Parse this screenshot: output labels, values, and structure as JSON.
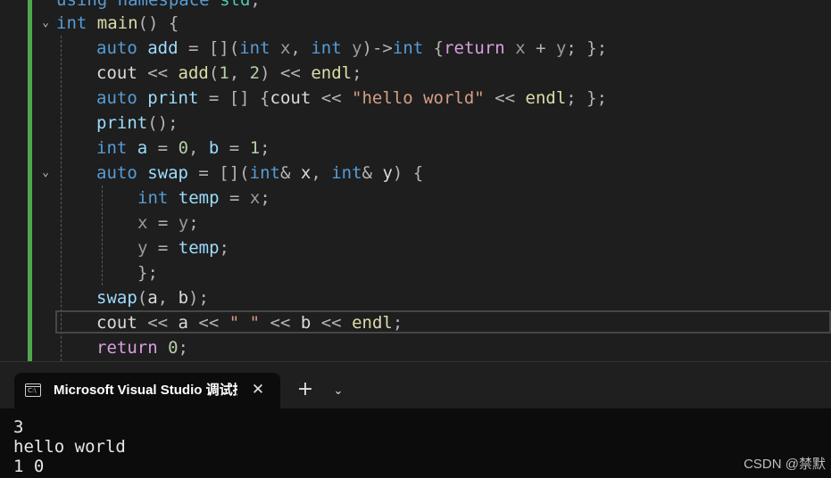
{
  "editor": {
    "lines": {
      "l0": {
        "a": "using",
        "b": "namespace",
        "c": "std",
        "d": ";"
      },
      "l1": {
        "a": "int",
        "b": "main",
        "c": "() {"
      },
      "l2": {
        "a": "auto",
        "b": "add",
        "c": " = [](",
        "d": "int",
        "e": "x",
        "f": ", ",
        "g": "int",
        "h": "y",
        "i": ")->",
        "j": "int",
        "k": " {",
        "l": "return",
        "m": "x",
        "n": " + ",
        "o": "y",
        "p": "; };"
      },
      "l3": {
        "a": "cout",
        "b": " << ",
        "c": "add",
        "d": "(",
        "e": "1",
        "f": ", ",
        "g": "2",
        "h": ") << ",
        "i": "endl",
        "j": ";"
      },
      "l4": {
        "a": "auto",
        "b": "print",
        "c": " = [] {",
        "d": "cout",
        "e": " << ",
        "f": "\"hello world\"",
        "g": " << ",
        "h": "endl",
        "i": "; };"
      },
      "l5": {
        "a": "print",
        "b": "();"
      },
      "l6": {
        "a": "int",
        "b": "a",
        "c": " = ",
        "d": "0",
        "e": ", ",
        "f": "b",
        "g": " = ",
        "h": "1",
        "i": ";"
      },
      "l7": {
        "a": "auto",
        "b": "swap",
        "c": " = [](",
        "d": "int",
        "e": "&",
        "f": "x",
        "g": ", ",
        "h": "int",
        "i": "&",
        "j": "y",
        "k": ") {"
      },
      "l8": {
        "a": "int",
        "b": "temp",
        "c": " = ",
        "d": "x",
        "e": ";"
      },
      "l9": {
        "a": "x",
        "b": " = ",
        "c": "y",
        "d": ";"
      },
      "l10": {
        "a": "y",
        "b": " = ",
        "c": "temp",
        "d": ";"
      },
      "l11": {
        "a": "};"
      },
      "l12": {
        "a": "swap",
        "b": "(",
        "c": "a",
        "d": ", ",
        "e": "b",
        "f": ");"
      },
      "l13": {
        "a": "cout",
        "b": " << ",
        "c": "a",
        "d": " << ",
        "e": "\" \"",
        "f": " << ",
        "g": "b",
        "h": " << ",
        "i": "endl",
        "j": ";"
      },
      "l14": {
        "a": "return",
        "b": " ",
        "c": "0",
        "d": ";"
      }
    },
    "fold_icon": "chevron-down-icon"
  },
  "terminal": {
    "tab_icon": "console-icon",
    "tab_icon_text": "C:\\",
    "tab_title": "Microsoft Visual Studio 调试控制台",
    "close_icon": "close-icon",
    "close_glyph": "✕",
    "new_tab_glyph": "+",
    "dropdown_glyph": "⌄",
    "output": [
      "3",
      "hello world",
      "1 0"
    ]
  },
  "watermark": "CSDN @禁默",
  "colors": {
    "keyword": "#569cd6",
    "function": "#dcdcaa",
    "number": "#b5cea8",
    "string": "#d69d85",
    "variable": "#9cdcfe",
    "control": "#d8a0df",
    "gutter_change": "#4fa94c",
    "terminal_bg": "#0c0c0c"
  }
}
